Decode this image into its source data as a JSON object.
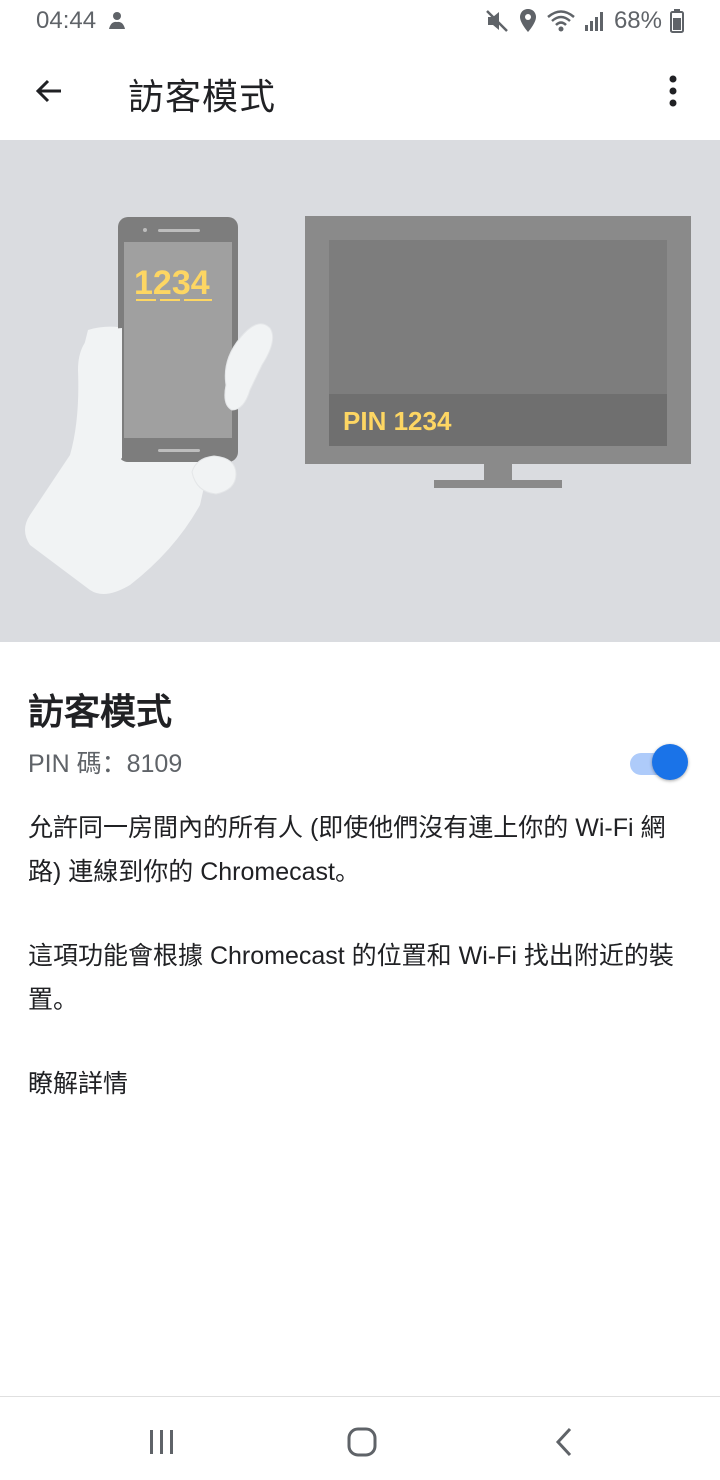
{
  "status_bar": {
    "time": "04:44",
    "battery": "68%",
    "icons": [
      "notification-icon",
      "mute-icon",
      "location-icon",
      "wifi-icon",
      "signal-icon",
      "battery-icon"
    ]
  },
  "app_bar": {
    "title": "訪客模式",
    "back_icon": "arrow-back-icon",
    "menu_icon": "more-vert-icon"
  },
  "hero": {
    "phone_pin": "1234",
    "tv_pin": "PIN 1234",
    "colors": {
      "background": "#dadce0",
      "device": "#8a8a8a",
      "pin_text": "#fdd663"
    }
  },
  "guest_mode": {
    "title": "訪客模式",
    "pin_label": "PIN 碼：8109",
    "toggle_on": true,
    "description_1": "允許同一房間內的所有人 (即使他們沒有連上你的 Wi-Fi 網路) 連線到你的 Chromecast。",
    "description_2": "這項功能會根據 Chromecast 的位置和 Wi-Fi 找出附近的裝置。",
    "learn_more": "瞭解詳情"
  },
  "nav_bar": {
    "icons": [
      "recent-apps-icon",
      "home-icon",
      "back-nav-icon"
    ]
  },
  "colors": {
    "accent": "#1a73e8",
    "accent_track": "#aecbfa",
    "text_primary": "#202124",
    "text_secondary": "#5f6368"
  }
}
